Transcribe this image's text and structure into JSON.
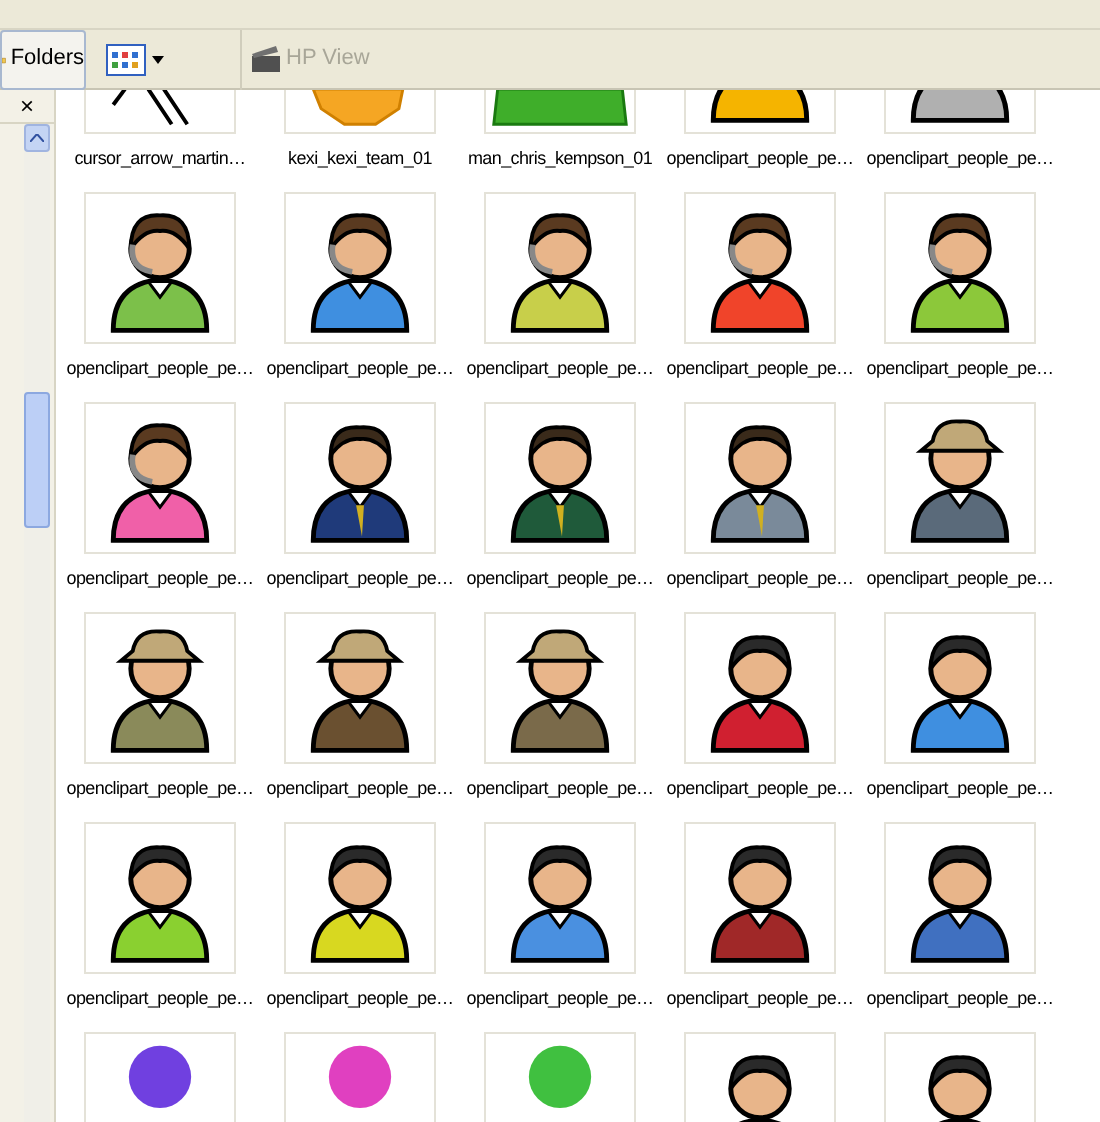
{
  "toolbar": {
    "folders_button": "Folders",
    "hp_view": {
      "label": "HP View",
      "disabled": true
    }
  },
  "pane_close": "×",
  "files": [
    {
      "kind": "arrow",
      "label": "cursor_arrow_martin…"
    },
    {
      "kind": "gear",
      "label": "kexi_kexi_team_01",
      "color": "#f5a623"
    },
    {
      "kind": "shape",
      "label": "man_chris_kempson_01",
      "color": "#3fae2a"
    },
    {
      "kind": "person",
      "label": "openclipart_people_pe…",
      "color": "#f5b400"
    },
    {
      "kind": "person",
      "label": "openclipart_people_pe…",
      "color": "#b0b0b0"
    },
    {
      "kind": "headset",
      "label": "openclipart_people_pe…",
      "color": "#7cc04a"
    },
    {
      "kind": "headset",
      "label": "openclipart_people_pe…",
      "color": "#3f8fe0"
    },
    {
      "kind": "headset",
      "label": "openclipart_people_pe…",
      "color": "#c8cf4a"
    },
    {
      "kind": "headset",
      "label": "openclipart_people_pe…",
      "color": "#f0442a"
    },
    {
      "kind": "headset",
      "label": "openclipart_people_pe…",
      "color": "#8cc83a"
    },
    {
      "kind": "headset",
      "label": "openclipart_people_pe…",
      "color": "#f060a8"
    },
    {
      "kind": "suit",
      "label": "openclipart_people_pe…",
      "color": "#1f3a7a"
    },
    {
      "kind": "suit",
      "label": "openclipart_people_pe…",
      "color": "#1f5a3a"
    },
    {
      "kind": "suit",
      "label": "openclipart_people_pe…",
      "color": "#7a8a9a"
    },
    {
      "kind": "hat",
      "label": "openclipart_people_pe…",
      "color": "#5a6a7a"
    },
    {
      "kind": "hat",
      "label": "openclipart_people_pe…",
      "color": "#8a8a5a"
    },
    {
      "kind": "hat",
      "label": "openclipart_people_pe…",
      "color": "#6a5030"
    },
    {
      "kind": "hat",
      "label": "openclipart_people_pe…",
      "color": "#7a6a4a"
    },
    {
      "kind": "person",
      "label": "openclipart_people_pe…",
      "color": "#d02030"
    },
    {
      "kind": "person",
      "label": "openclipart_people_pe…",
      "color": "#3f8fe0"
    },
    {
      "kind": "person",
      "label": "openclipart_people_pe…",
      "color": "#8ad030"
    },
    {
      "kind": "person",
      "label": "openclipart_people_pe…",
      "color": "#d8d820"
    },
    {
      "kind": "person",
      "label": "openclipart_people_pe…",
      "color": "#4a90e0"
    },
    {
      "kind": "person",
      "label": "openclipart_people_pe…",
      "color": "#a02828"
    },
    {
      "kind": "person",
      "label": "openclipart_people_pe…",
      "color": "#4070c0"
    },
    {
      "kind": "ball",
      "color": "#7040e0"
    },
    {
      "kind": "ball",
      "color": "#e040c0"
    },
    {
      "kind": "ball",
      "color": "#40c040"
    },
    {
      "kind": "person"
    },
    {
      "kind": "person"
    }
  ]
}
